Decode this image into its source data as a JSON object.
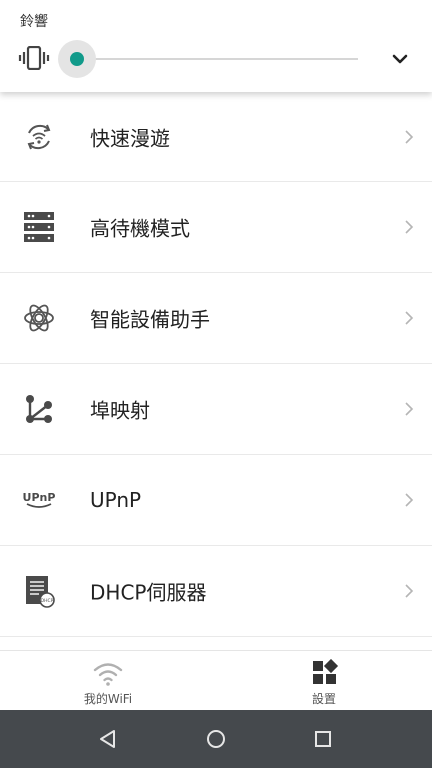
{
  "volume": {
    "label": "鈴響",
    "level_percent": 0,
    "accent_color": "#119a8a",
    "icon": "vibrate-icon",
    "expand_icon": "chevron-down-icon"
  },
  "menu": {
    "items": [
      {
        "label": "快速漫遊",
        "icon": "fast-roaming-icon"
      },
      {
        "label": "高待機模式",
        "icon": "standby-server-icon"
      },
      {
        "label": "智能設備助手",
        "icon": "smart-device-icon"
      },
      {
        "label": "埠映射",
        "icon": "port-mapping-icon"
      },
      {
        "label": "UPnP",
        "icon": "upnp-icon",
        "icon_text": "UPnP"
      },
      {
        "label": "DHCP伺服器",
        "icon": "dhcp-server-icon",
        "icon_text": "DHCP"
      }
    ]
  },
  "tabs": [
    {
      "label": "我的WiFi",
      "icon": "wifi-icon",
      "active": false
    },
    {
      "label": "設置",
      "icon": "settings-grid-icon",
      "active": true
    }
  ],
  "system_nav": {
    "buttons": [
      "back-icon",
      "home-icon",
      "recents-icon"
    ]
  }
}
